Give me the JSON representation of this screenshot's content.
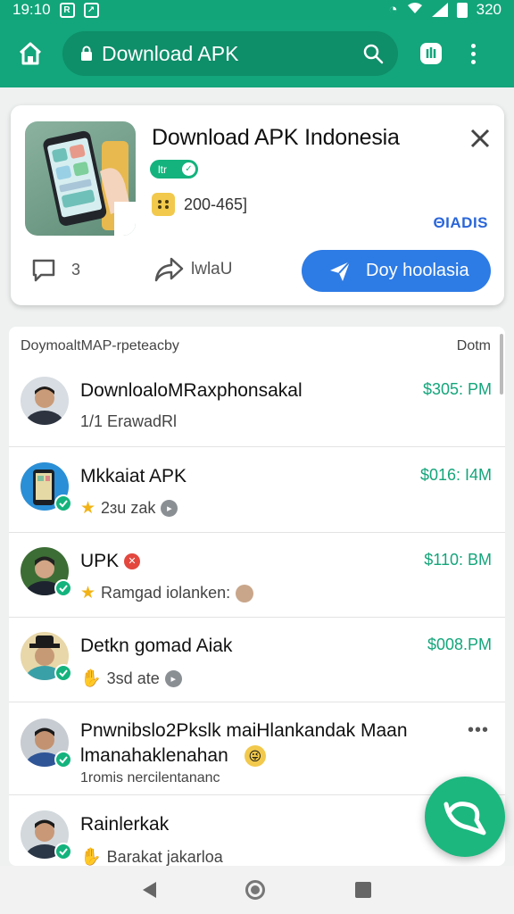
{
  "status_bar": {
    "time": "19:10",
    "battery": "320",
    "icons": [
      "r-box-icon",
      "arrow-box-icon",
      "alarm-icon",
      "wifi-icon",
      "signal-icon",
      "battery-icon"
    ]
  },
  "toolbar": {
    "url_text": "Download APK",
    "icons": [
      "home-icon",
      "lock-icon",
      "search-icon",
      "tabs-icon",
      "more-vert-icon"
    ]
  },
  "app_card": {
    "title": "Download APK Indonesia",
    "badge": "ltr",
    "downloads": "200-465]",
    "brand": "ΘIADIS",
    "comment_count": "3",
    "share_label": "lwlaU",
    "cta_label": "Doy hoolasia"
  },
  "list": {
    "header_left": "DoymoaltMAP-rpeteacby",
    "header_right": "Dotm",
    "items": [
      {
        "name": "DownloaloMRaxphonsakal",
        "time": "$305: PM",
        "sub": "1/1 ErawadRl"
      },
      {
        "name": "Mkkaiat APK",
        "time": "$016: I4M",
        "sub": "2ɜu zak"
      },
      {
        "name": "UPK",
        "time": "$110: BM",
        "sub": "Ramgad iolanken:"
      },
      {
        "name": "Detkn gomad Aiak",
        "time": "$008.PM",
        "sub": "3sd ate"
      },
      {
        "name": "Pnwnibslo2Pkslk maiHlankandak Maan",
        "name2": "lmanahaklenahan",
        "sub": "1romis nercilentananc"
      },
      {
        "name": "Rainlerkak",
        "sub": "Barakat jakarloa"
      }
    ]
  },
  "colors": {
    "brand_green": "#13a57b",
    "cta_blue": "#2d7be5",
    "time_green": "#14a57a"
  }
}
